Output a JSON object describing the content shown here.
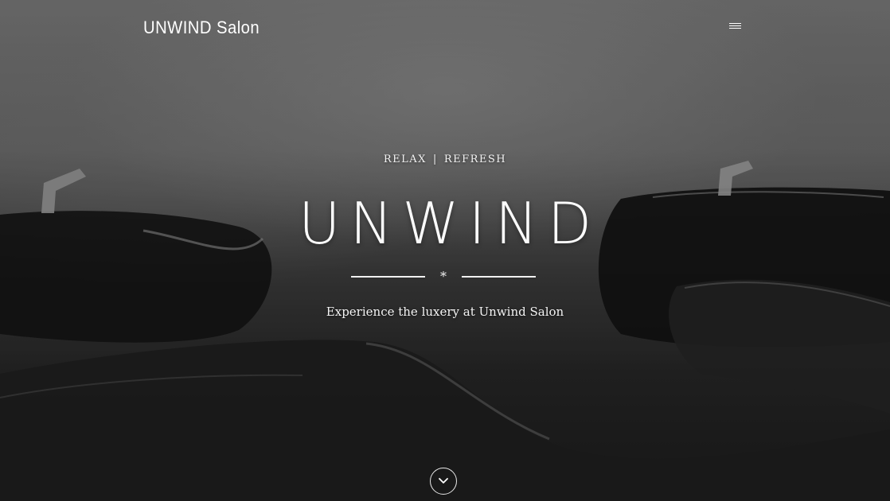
{
  "header": {
    "logo_text": "UNWIND Salon",
    "menu_icon": "hamburger-menu-icon"
  },
  "hero": {
    "kicker_left": "RELAX",
    "kicker_separator": "|",
    "kicker_right": "REFRESH",
    "title": "UNWIND",
    "divider_glyph": "*",
    "tagline": "Experience the luxery at Unwind Salon",
    "scroll_icon": "chevron-down-icon"
  },
  "colors": {
    "text": "#ffffff",
    "background_dark": "#1c1c1c",
    "background_light": "#7b7b7b"
  }
}
